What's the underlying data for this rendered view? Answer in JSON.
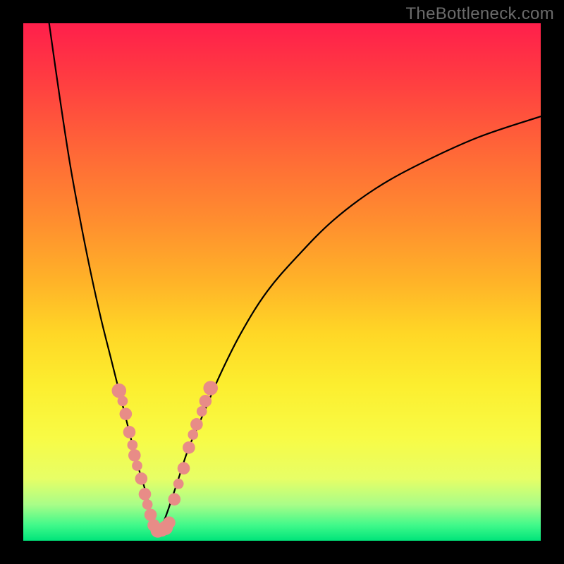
{
  "watermark": "TheBottleneck.com",
  "chart_data": {
    "type": "line",
    "title": "",
    "xlabel": "",
    "ylabel": "",
    "xlim": [
      0,
      100
    ],
    "ylim": [
      0,
      100
    ],
    "grid": false,
    "series": [
      {
        "name": "left-curve",
        "x": [
          5,
          7,
          9,
          11,
          13,
          15,
          17,
          19,
          20.5,
          22,
          23.5,
          24.5,
          25.5
        ],
        "y": [
          100,
          86,
          73,
          62,
          52,
          43,
          35,
          27,
          21,
          15,
          10,
          6,
          2
        ]
      },
      {
        "name": "right-curve",
        "x": [
          26.5,
          28,
          30,
          32,
          35,
          38,
          42,
          47,
          53,
          60,
          68,
          77,
          88,
          100
        ],
        "y": [
          2,
          6,
          12,
          18,
          25,
          32,
          40,
          48,
          55,
          62,
          68,
          73,
          78,
          82
        ]
      }
    ],
    "scatter": [
      {
        "name": "left-dots",
        "points": [
          {
            "x": 18.5,
            "y": 29,
            "r": 1.4
          },
          {
            "x": 19.2,
            "y": 27,
            "r": 1.0
          },
          {
            "x": 19.8,
            "y": 24.5,
            "r": 1.2
          },
          {
            "x": 20.5,
            "y": 21,
            "r": 1.2
          },
          {
            "x": 21.1,
            "y": 18.5,
            "r": 1.0
          },
          {
            "x": 21.5,
            "y": 16.5,
            "r": 1.2
          },
          {
            "x": 22.0,
            "y": 14.5,
            "r": 1.0
          },
          {
            "x": 22.8,
            "y": 12,
            "r": 1.2
          },
          {
            "x": 23.5,
            "y": 9,
            "r": 1.2
          },
          {
            "x": 24.0,
            "y": 7,
            "r": 1.0
          },
          {
            "x": 24.6,
            "y": 5,
            "r": 1.2
          },
          {
            "x": 25.2,
            "y": 3,
            "r": 1.2
          },
          {
            "x": 26.0,
            "y": 2,
            "r": 1.4
          },
          {
            "x": 26.8,
            "y": 2,
            "r": 1.2
          },
          {
            "x": 27.5,
            "y": 2.5,
            "r": 1.4
          },
          {
            "x": 28.2,
            "y": 3.5,
            "r": 1.2
          }
        ]
      },
      {
        "name": "right-dots",
        "points": [
          {
            "x": 29.2,
            "y": 8,
            "r": 1.2
          },
          {
            "x": 30.0,
            "y": 11,
            "r": 1.0
          },
          {
            "x": 31.0,
            "y": 14,
            "r": 1.2
          },
          {
            "x": 32.0,
            "y": 18,
            "r": 1.2
          },
          {
            "x": 32.8,
            "y": 20.5,
            "r": 1.0
          },
          {
            "x": 33.5,
            "y": 22.5,
            "r": 1.2
          },
          {
            "x": 34.5,
            "y": 25,
            "r": 1.0
          },
          {
            "x": 35.2,
            "y": 27,
            "r": 1.2
          },
          {
            "x": 36.2,
            "y": 29.5,
            "r": 1.4
          }
        ]
      }
    ],
    "colors": {
      "curve": "#000000",
      "dots": "#e88c87",
      "background_top": "#ff1f4b",
      "background_bottom": "#00e47a"
    }
  }
}
